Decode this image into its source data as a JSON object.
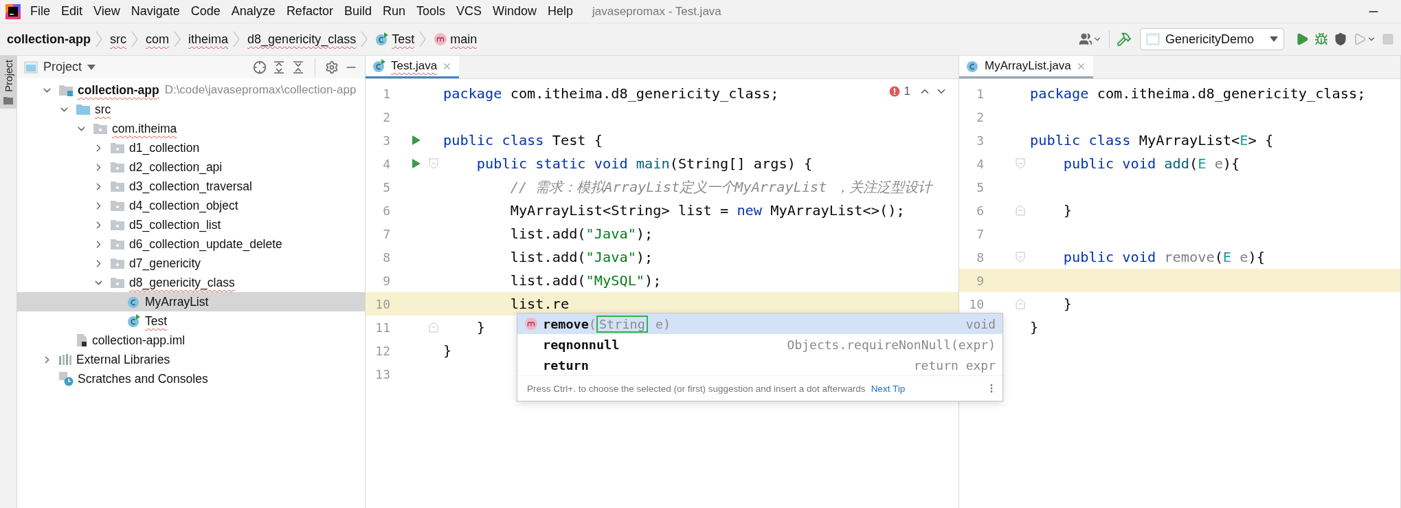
{
  "menu_bar": {
    "items": [
      "File",
      "Edit",
      "View",
      "Navigate",
      "Code",
      "Analyze",
      "Refactor",
      "Build",
      "Run",
      "Tools",
      "VCS",
      "Window",
      "Help"
    ],
    "title": "javasepromax - Test.java"
  },
  "breadcrumb": [
    {
      "label": "collection-app",
      "kind": "project",
      "error": false
    },
    {
      "label": "src",
      "kind": "text",
      "error": true
    },
    {
      "label": "com",
      "kind": "text",
      "error": true
    },
    {
      "label": "itheima",
      "kind": "text",
      "error": true
    },
    {
      "label": "d8_genericity_class",
      "kind": "text",
      "error": true
    },
    {
      "label": "Test",
      "kind": "class",
      "error": true
    },
    {
      "label": "main",
      "kind": "method",
      "error": true
    }
  ],
  "toolbar": {
    "run_config": "GenericityDemo"
  },
  "project_panel": {
    "side_tab": "Project",
    "title": "Project",
    "tree": [
      {
        "label": "collection-app",
        "kind": "module",
        "path": "D:\\code\\javasepromax\\collection-app",
        "expanded": true,
        "selected": false,
        "error": true,
        "children": [
          {
            "label": "src",
            "kind": "source",
            "expanded": true,
            "selected": false,
            "error": true,
            "children": [
              {
                "label": "com.itheima",
                "kind": "package",
                "expanded": true,
                "selected": false,
                "error": true,
                "children": [
                  {
                    "label": "d1_collection",
                    "kind": "package",
                    "expanded": false,
                    "selected": false,
                    "error": false
                  },
                  {
                    "label": "d2_collection_api",
                    "kind": "package",
                    "expanded": false,
                    "selected": false,
                    "error": false
                  },
                  {
                    "label": "d3_collection_traversal",
                    "kind": "package",
                    "expanded": false,
                    "selected": false,
                    "error": false
                  },
                  {
                    "label": "d4_collection_object",
                    "kind": "package",
                    "expanded": false,
                    "selected": false,
                    "error": false
                  },
                  {
                    "label": "d5_collection_list",
                    "kind": "package",
                    "expanded": false,
                    "selected": false,
                    "error": false
                  },
                  {
                    "label": "d6_collection_update_delete",
                    "kind": "package",
                    "expanded": false,
                    "selected": false,
                    "error": false
                  },
                  {
                    "label": "d7_genericity",
                    "kind": "package",
                    "expanded": false,
                    "selected": false,
                    "error": false
                  },
                  {
                    "label": "d8_genericity_class",
                    "kind": "package",
                    "expanded": true,
                    "selected": false,
                    "error": true,
                    "children": [
                      {
                        "label": "MyArrayList",
                        "kind": "class",
                        "selected": true,
                        "error": false
                      },
                      {
                        "label": "Test",
                        "kind": "runnable",
                        "selected": false,
                        "error": true
                      }
                    ]
                  }
                ]
              }
            ]
          },
          {
            "label": "collection-app.iml",
            "kind": "iml",
            "selected": false,
            "error": false
          }
        ]
      },
      {
        "label": "External Libraries",
        "kind": "libraries",
        "expanded": false,
        "selected": false,
        "error": false
      },
      {
        "label": "Scratches and Consoles",
        "kind": "scratches",
        "selected": false,
        "error": false
      }
    ]
  },
  "editors": [
    {
      "tab": {
        "label": "Test.java",
        "selected": true,
        "error": true
      },
      "error_count": "1",
      "lines": [
        {
          "no": "1",
          "current": false,
          "run": false,
          "tokens": [
            {
              "kind": "kw",
              "text": "package"
            },
            {
              "kind": "plain",
              "text": " com.itheima.d8_genericity_class;"
            }
          ]
        },
        {
          "no": "2",
          "current": false,
          "run": false
        },
        {
          "no": "3",
          "current": false,
          "run": true,
          "tokens": [
            {
              "kind": "kw",
              "text": "public class"
            },
            {
              "kind": "plain",
              "text": " Test {"
            }
          ]
        },
        {
          "no": "4",
          "current": false,
          "run": true,
          "fold": {
            "kind": "start"
          },
          "tokens": [
            {
              "kind": "kw",
              "text": "    public static void"
            },
            {
              "kind": "method",
              "text": " main"
            },
            {
              "kind": "plain",
              "text": "(String[] args) {"
            }
          ]
        },
        {
          "no": "5",
          "current": false,
          "run": false,
          "tokens": [
            {
              "kind": "comment",
              "text": "        // 需求：模拟ArrayList定义一个MyArrayList ，关注泛型设计"
            }
          ]
        },
        {
          "no": "6",
          "current": false,
          "run": false,
          "tokens": [
            {
              "kind": "plain",
              "text": "        MyArrayList<String> list = "
            },
            {
              "kind": "kw",
              "text": "new"
            },
            {
              "kind": "plain",
              "text": " MyArrayList<>();"
            }
          ]
        },
        {
          "no": "7",
          "current": false,
          "run": false,
          "tokens": [
            {
              "kind": "plain",
              "text": "        list.add("
            },
            {
              "kind": "str",
              "text": "\"Java\""
            },
            {
              "kind": "plain",
              "text": ");"
            }
          ]
        },
        {
          "no": "8",
          "current": false,
          "run": false,
          "tokens": [
            {
              "kind": "plain",
              "text": "        list.add("
            },
            {
              "kind": "str",
              "text": "\"Java\""
            },
            {
              "kind": "plain",
              "text": ");"
            }
          ]
        },
        {
          "no": "9",
          "current": false,
          "run": false,
          "tokens": [
            {
              "kind": "plain",
              "text": "        list.add("
            },
            {
              "kind": "str",
              "text": "\"MySQL\""
            },
            {
              "kind": "plain",
              "text": ");"
            }
          ]
        },
        {
          "no": "10",
          "current": true,
          "run": false,
          "tokens": [
            {
              "kind": "plain",
              "text": "        list.re"
            }
          ]
        },
        {
          "no": "11",
          "current": false,
          "run": false,
          "fold": {
            "kind": "end"
          },
          "tokens": [
            {
              "kind": "plain",
              "text": "    }"
            }
          ]
        },
        {
          "no": "12",
          "current": false,
          "run": false,
          "tokens": [
            {
              "kind": "plain",
              "text": "}"
            }
          ]
        },
        {
          "no": "13",
          "current": false,
          "run": false
        }
      ],
      "completion": {
        "items": [
          {
            "name": "remove",
            "kind": "method",
            "signature": [
              "(",
              "String",
              " e)"
            ],
            "tail": "void",
            "selected": true
          },
          {
            "name": "reqnonnull",
            "kind": "template",
            "tail": "Objects.requireNonNull(expr)",
            "selected": false
          },
          {
            "name": "return",
            "kind": "template",
            "tail": "return expr",
            "selected": false
          }
        ],
        "hint": "Press Ctrl+. to choose the selected (or first) suggestion and insert a dot afterwards",
        "hint_link": "Next Tip"
      }
    },
    {
      "tab": {
        "label": "MyArrayList.java",
        "selected": false,
        "error": false
      },
      "lines": [
        {
          "no": "1",
          "current": false,
          "tokens": [
            {
              "kind": "kw",
              "text": "package"
            },
            {
              "kind": "plain",
              "text": " com.itheima.d8_genericity_class;"
            }
          ]
        },
        {
          "no": "2",
          "current": false
        },
        {
          "no": "3",
          "current": false,
          "tokens": [
            {
              "kind": "kw",
              "text": "public class"
            },
            {
              "kind": "plain",
              "text": " MyArrayList<"
            },
            {
              "kind": "typeparam",
              "text": "E"
            },
            {
              "kind": "plain",
              "text": "> {"
            }
          ]
        },
        {
          "no": "4",
          "current": false,
          "fold": {
            "kind": "start"
          },
          "tokens": [
            {
              "kind": "kw",
              "text": "    public void"
            },
            {
              "kind": "method",
              "text": " add"
            },
            {
              "kind": "plain",
              "text": "("
            },
            {
              "kind": "typeparam",
              "text": "E"
            },
            {
              "kind": "unused",
              "text": " e"
            },
            {
              "kind": "plain",
              "text": "){"
            }
          ]
        },
        {
          "no": "5",
          "current": false
        },
        {
          "no": "6",
          "current": false,
          "fold": {
            "kind": "end"
          },
          "tokens": [
            {
              "kind": "plain",
              "text": "    }"
            }
          ]
        },
        {
          "no": "7",
          "current": false
        },
        {
          "no": "8",
          "current": false,
          "fold": {
            "kind": "start"
          },
          "tokens": [
            {
              "kind": "kw",
              "text": "    public void"
            },
            {
              "kind": "unused",
              "text": " remove"
            },
            {
              "kind": "plain",
              "text": "("
            },
            {
              "kind": "typeparam",
              "text": "E"
            },
            {
              "kind": "unused",
              "text": " e"
            },
            {
              "kind": "plain",
              "text": "){"
            }
          ]
        },
        {
          "no": "9",
          "current": true
        },
        {
          "no": "10",
          "current": false,
          "fold": {
            "kind": "end"
          },
          "tokens": [
            {
              "kind": "plain",
              "text": "    }"
            }
          ]
        },
        {
          "current": false,
          "tokens": [
            {
              "kind": "plain",
              "text": "}"
            }
          ]
        }
      ]
    }
  ]
}
